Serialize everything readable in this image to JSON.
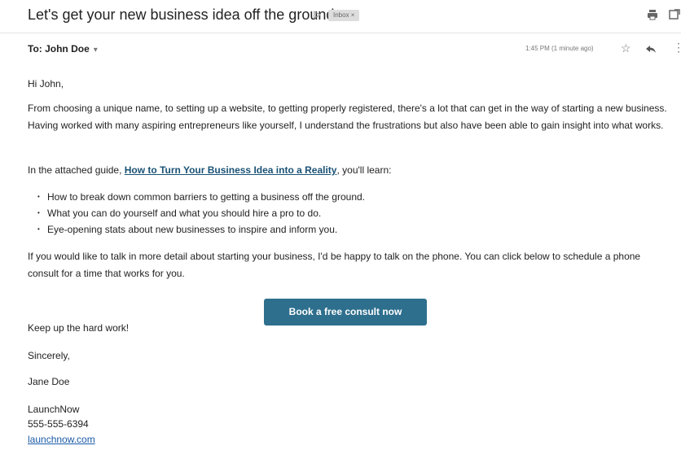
{
  "header": {
    "subject": "Let's get your new business idea off the ground",
    "inbox_label": "Inbox ×"
  },
  "meta": {
    "to_line": "To: John Doe",
    "timestamp": "1:45 PM (1 minute ago)"
  },
  "body": {
    "greeting": "Hi John,",
    "para1": "From choosing a unique name, to setting up a website, to getting properly registered, there's a lot that can get in the way of starting a new business. Having worked with many aspiring entrepreneurs like yourself, I understand the frustrations but also have been able to gain insight into what works.",
    "para2_prefix": "In the attached guide, ",
    "guide_link": "How to Turn Your Business Idea into a Reality",
    "para2_suffix": ", you'll learn:",
    "bullets": [
      "How to break down common barriers to getting a business off the ground.",
      "What you can do yourself and what you should hire a pro to do.",
      "Eye-opening stats about new businesses to inspire and inform you."
    ],
    "para3": "If you would like to talk in more detail about starting your business, I'd be happy to talk on the phone. You can click below to schedule a phone consult for a time that works for you.",
    "cta_label": "Book a free consult now",
    "closing": "Keep up the hard work!",
    "sincerely": "Sincerely,",
    "signature_name": "Jane Doe",
    "company": "LaunchNow",
    "phone": "555-555-6394",
    "website": "launchnow.com"
  },
  "icons": {
    "important": "important-marker-icon",
    "print": "print-icon",
    "popout": "open-in-new-window-icon",
    "star": "star-icon",
    "reply": "reply-icon",
    "more": "more-vertical-icon"
  },
  "colors": {
    "accent_button": "#2e6f8e",
    "link": "#1a5276",
    "text": "#222222",
    "muted": "#777777"
  }
}
